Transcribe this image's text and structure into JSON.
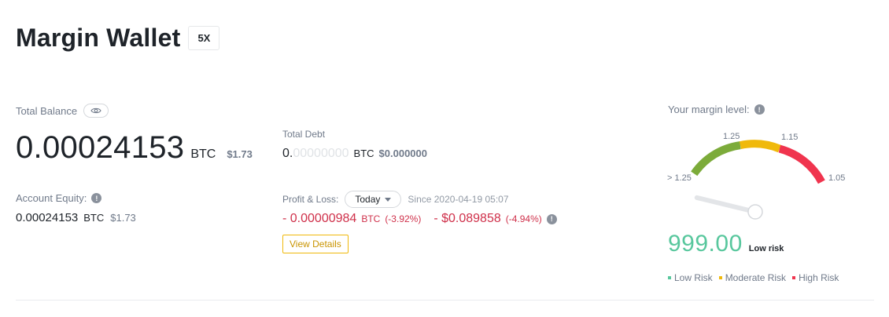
{
  "header": {
    "title": "Margin Wallet",
    "leverage": "5X"
  },
  "balance": {
    "label": "Total Balance",
    "value": "0.00024153",
    "unit": "BTC",
    "usd": "$1.73"
  },
  "equity": {
    "label": "Account Equity:",
    "value": "0.00024153",
    "unit": "BTC",
    "usd": "$1.73"
  },
  "debt": {
    "label": "Total Debt",
    "value_lead": "0.",
    "value_faint": "00000000",
    "unit": "BTC",
    "usd": "$0.000000"
  },
  "pnl": {
    "label": "Profit & Loss:",
    "period": "Today",
    "since": "Since 2020-04-19 05:07",
    "btc_value": "- 0.00000984",
    "btc_unit": "BTC",
    "btc_pct": "(-3.92%)",
    "usd_value": "- $0.089858",
    "usd_pct": "(-4.94%)",
    "details_label": "View Details"
  },
  "margin": {
    "label": "Your margin level:",
    "level": "999.00",
    "risk_text": "Low risk",
    "level_fraction": 0,
    "gauge_labels": {
      "left": "> 1.25",
      "top_left": "1.25",
      "top_right": "1.15",
      "right": "1.05"
    },
    "colors": {
      "low": "#7cab3a",
      "moderate": "#f0b90b",
      "high": "#f0344e"
    },
    "legend": [
      {
        "label": "Low Risk",
        "color": "#58c79d"
      },
      {
        "label": "Moderate Risk",
        "color": "#f0b90b"
      },
      {
        "label": "High Risk",
        "color": "#f0344e"
      }
    ]
  },
  "icons": {
    "eye": "eye-icon",
    "info": "info-icon",
    "caret": "chevron-down-icon"
  }
}
